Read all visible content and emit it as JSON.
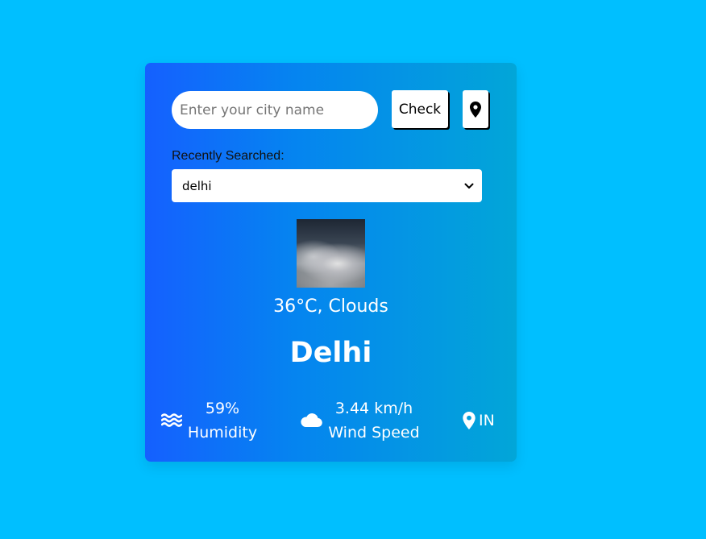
{
  "search": {
    "placeholder": "Enter your city name",
    "value": "",
    "check_label": "Check",
    "location_icon": "map-marker-icon"
  },
  "recent": {
    "label": "Recently Searched:",
    "selected": "delhi",
    "chevron_icon": "chevron-down-icon"
  },
  "weather": {
    "image_description_icon": "clouds-photo",
    "temp_condition": "36°C, Clouds",
    "city": "Delhi"
  },
  "stats": {
    "humidity": {
      "icon": "water-waves-icon",
      "value": "59%",
      "label": "Humidity"
    },
    "wind": {
      "icon": "cloud-icon",
      "value": "3.44 km/h",
      "label": "Wind Speed"
    },
    "country": {
      "icon": "map-marker-icon",
      "value": "IN"
    }
  },
  "colors": {
    "page_background": "#00BFFF",
    "card_gradient_start": "#1560FF",
    "card_gradient_end": "#02A6D8",
    "text": "#FFFFFF"
  }
}
